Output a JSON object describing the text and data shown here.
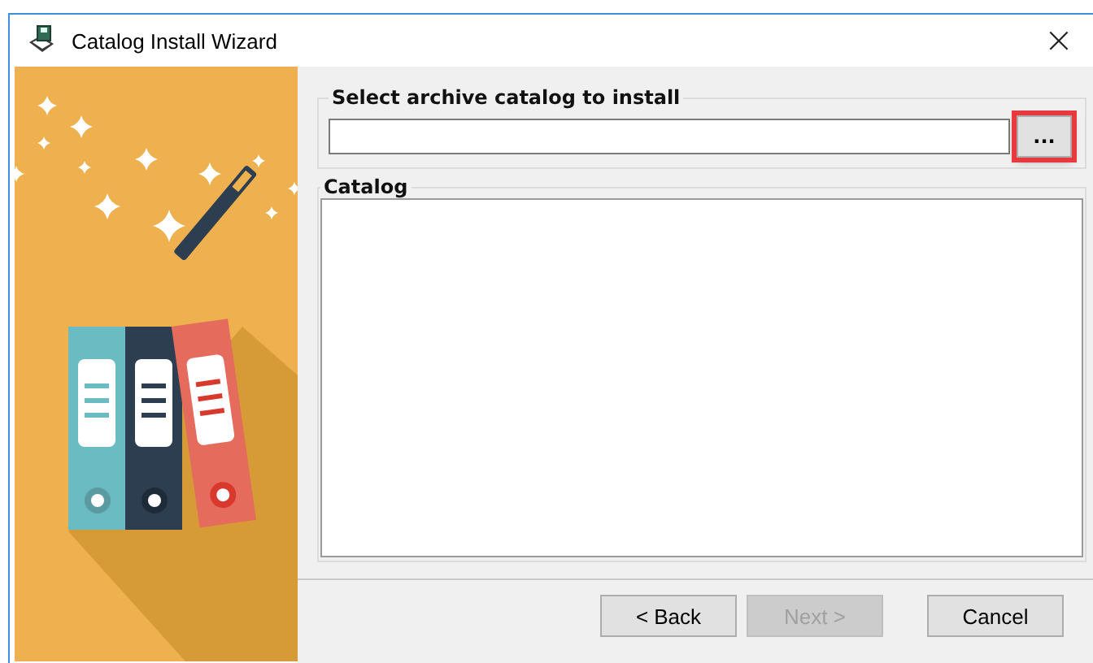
{
  "window": {
    "title": "Catalog Install Wizard",
    "close": "×"
  },
  "archive_group": {
    "title": "Select archive catalog to install",
    "browse_button": {
      "label": "...",
      "highlighted": true
    }
  },
  "catalog_group": {
    "title": "Catalog"
  },
  "buttons": [
    {
      "label": "< Back",
      "disabled": false
    },
    {
      "label": "Next >",
      "disabled": true
    },
    {
      "label": "Cancel",
      "disabled": false
    }
  ]
}
